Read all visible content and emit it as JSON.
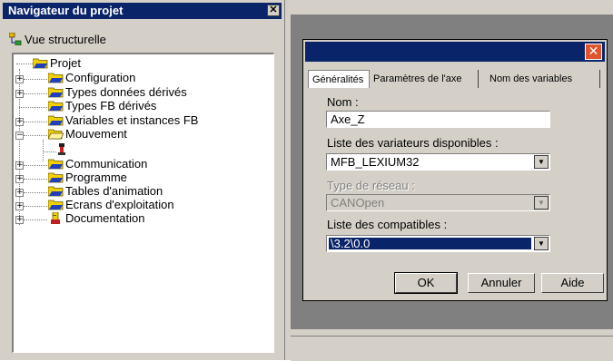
{
  "navigator": {
    "title": "Navigateur du projet",
    "close_icon": "close-icon",
    "view_label": "Vue structurelle",
    "tree": [
      {
        "label": "Projet",
        "icon": "folder-icon"
      },
      {
        "label": "Configuration",
        "icon": "folder-icon"
      },
      {
        "label": "Types données dérivés",
        "icon": "folder-icon"
      },
      {
        "label": "Types FB dérivés",
        "icon": "folder-icon"
      },
      {
        "label": "Variables et instances FB",
        "icon": "folder-icon"
      },
      {
        "label": "Mouvement",
        "icon": "folder-open-icon"
      },
      {
        "label": "Communication",
        "icon": "folder-icon"
      },
      {
        "label": "Programme",
        "icon": "folder-icon"
      },
      {
        "label": "Tables d'animation",
        "icon": "folder-icon"
      },
      {
        "label": "Ecrans d'exploitation",
        "icon": "folder-icon"
      },
      {
        "label": "Documentation",
        "icon": "document-icon"
      }
    ]
  },
  "dialog": {
    "close_icon": "close-icon",
    "tabs": [
      "Généralités",
      "Paramètres de l'axe",
      "Nom des variables"
    ],
    "nom_label": "Nom :",
    "nom_value": "Axe_Z",
    "variateurs_label": "Liste des variateurs disponibles :",
    "variateurs_value": "MFB_LEXIUM32",
    "reseau_label": "Type de réseau :",
    "reseau_value": "CANOpen",
    "compatibles_label": "Liste des compatibles :",
    "compatibles_value": "\\3.2\\0.0",
    "ok_label": "OK",
    "annuler_label": "Annuler",
    "aide_label": "Aide"
  },
  "colors": {
    "titlebar": "#0a246a",
    "face": "#d4d0c8",
    "close_red": "#e0542e"
  }
}
